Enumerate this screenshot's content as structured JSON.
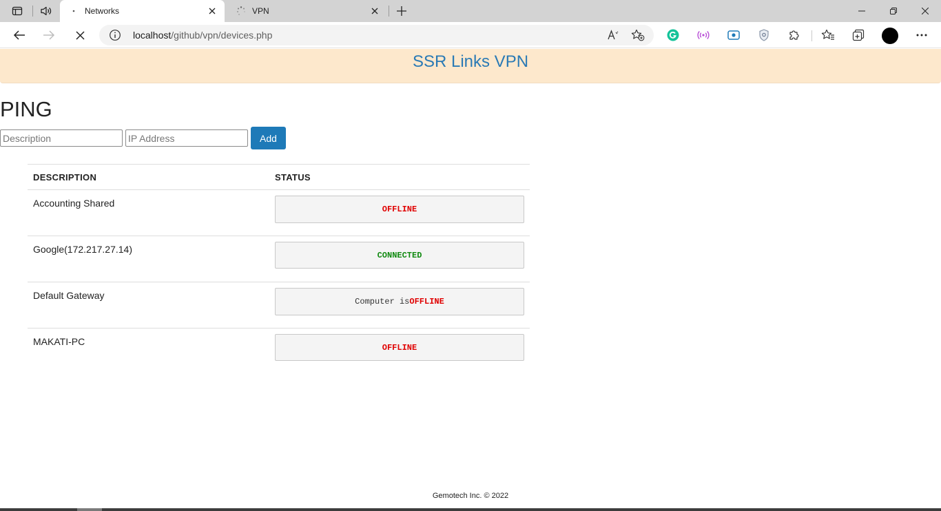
{
  "browser": {
    "tabs": [
      {
        "title": "Networks",
        "active": true
      },
      {
        "title": "VPN",
        "active": false
      }
    ],
    "address": {
      "host": "localhost",
      "path": "/github/vpn/devices.php"
    },
    "icons": {
      "sidebar": "tab-actions-icon",
      "read_aloud": "speaker-icon",
      "new_tab": "plus-icon",
      "back": "back-arrow-icon",
      "forward": "forward-arrow-icon",
      "stop": "stop-loading-icon",
      "info": "info-icon",
      "read_mode": "read-aloud-icon",
      "favorite": "add-favorite-icon",
      "extensions": [
        "grammarly-icon",
        "podcast-icon",
        "screen-capture-icon",
        "shield-icon",
        "extensions-puzzle-icon"
      ],
      "favorites": "favorites-icon",
      "collections": "collections-icon",
      "profile": "profile-avatar",
      "menu": "more-menu-icon"
    },
    "colors": {
      "grammarly": "#15c39a",
      "podcast": "#b84fd6",
      "capture": "#1e7ab8"
    }
  },
  "site": {
    "brand": "SSR Links VPN",
    "colors": {
      "banner_bg": "#fde8cc",
      "brand": "#2a7ab5",
      "button": "#1e7ab8",
      "offline": "#e00000",
      "connected": "#118a11"
    }
  },
  "ping": {
    "title": "PING",
    "description_placeholder": "Description",
    "ip_placeholder": "IP Address",
    "add_label": "Add"
  },
  "table": {
    "headers": {
      "description": "DESCRIPTION",
      "status": "STATUS"
    },
    "rows": [
      {
        "description": "Accounting Shared",
        "status_prefix": "",
        "status": "OFFLINE"
      },
      {
        "description": "Google(172.217.27.14)",
        "status_prefix": "",
        "status": "CONNECTED"
      },
      {
        "description": "Default Gateway",
        "status_prefix": "Computer is ",
        "status": "OFFLINE"
      },
      {
        "description": "MAKATI-PC",
        "status_prefix": "",
        "status": "OFFLINE"
      }
    ]
  },
  "footer": {
    "text": "Gemotech Inc. © 2022"
  }
}
